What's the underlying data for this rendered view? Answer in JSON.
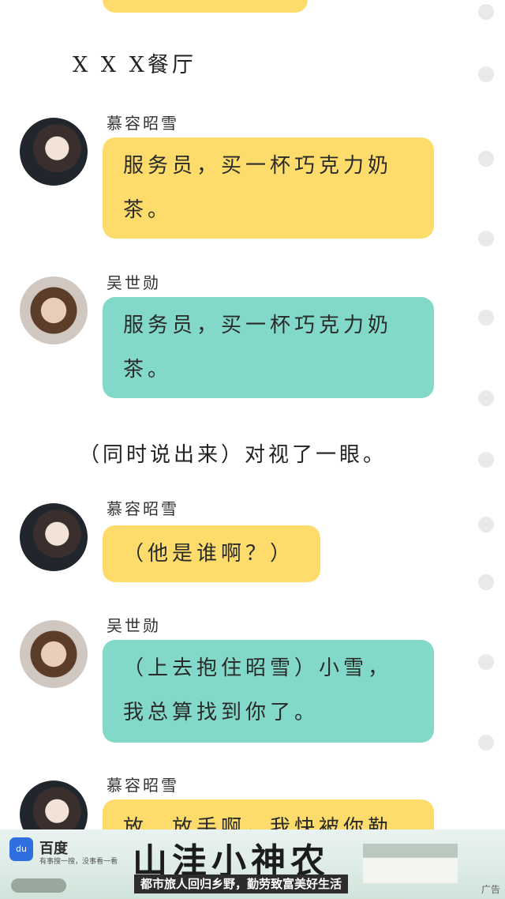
{
  "scene_label": "X X X餐厅",
  "narration": "（同时说出来）对视了一眼。",
  "messages": [
    {
      "speaker": "慕容昭雪",
      "text_line1": "服务员，买一杯巧克力奶",
      "text_line2": "茶。",
      "color": "#fddc6b"
    },
    {
      "speaker": "吴世勋",
      "text_line1": "服务员，买一杯巧克力奶",
      "text_line2": "茶。",
      "color": "#83d9c9"
    },
    {
      "speaker": "慕容昭雪",
      "text_line1": "（他是谁啊？）",
      "color": "#fddc6b"
    },
    {
      "speaker": "吴世勋",
      "text_line1": "（上去抱住昭雪）小雪，",
      "text_line2": "我总算找到你了。",
      "color": "#83d9c9"
    },
    {
      "speaker": "慕容昭雪",
      "text_line1": "放…放手啊，我快被你勒",
      "color": "#fddc6b"
    }
  ],
  "ad": {
    "logo_text": "du",
    "brand": "百度",
    "tagline": "有事搜一搜，没事看一看",
    "title": "山洼小神农",
    "subtitle": "都市旅人回归乡野，勤劳致富美好生活",
    "marker": "广告"
  }
}
